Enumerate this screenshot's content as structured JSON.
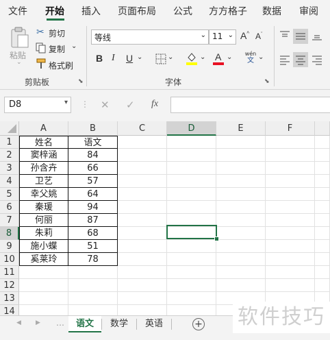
{
  "ribbon_tabs": [
    "文件",
    "开始",
    "插入",
    "页面布局",
    "公式",
    "方方格子",
    "数据",
    "审阅"
  ],
  "clipboard": {
    "paste_label": "粘贴",
    "cut_label": "剪切",
    "copy_label": "复制",
    "format_painter_label": "格式刷",
    "group_label": "剪贴板"
  },
  "font": {
    "font_name": "等线",
    "font_size": "11",
    "grow_label": "A",
    "shrink_label": "A",
    "bold_label": "B",
    "italic_label": "I",
    "underline_label": "U",
    "phonetic_top": "wén",
    "phonetic_bottom": "文",
    "color_label": "A",
    "group_label": "字体"
  },
  "colors": {
    "accent": "#217346",
    "highlight_swatch": "#ffff00",
    "font_color_swatch": "#e81123"
  },
  "formula_bar": {
    "name_box": "D8",
    "cancel_icon": "✕",
    "enter_icon": "✓",
    "fx_label": "fx",
    "formula_value": ""
  },
  "sheet": {
    "columns": [
      "A",
      "B",
      "C",
      "D",
      "E",
      "F"
    ],
    "rows": [
      "1",
      "2",
      "3",
      "4",
      "5",
      "6",
      "7",
      "8",
      "9",
      "10",
      "11",
      "12",
      "13",
      "14"
    ],
    "active_cell": "D8",
    "table": [
      [
        "姓名",
        "语文"
      ],
      [
        "窦梓涵",
        "84"
      ],
      [
        "孙含卉",
        "66"
      ],
      [
        "卫艺",
        "57"
      ],
      [
        "幸父姚",
        "64"
      ],
      [
        "秦瑗",
        "94"
      ],
      [
        "何丽",
        "87"
      ],
      [
        "朱莉",
        "68"
      ],
      [
        "施小蝶",
        "51"
      ],
      [
        "奚莱玲",
        "78"
      ]
    ]
  },
  "sheet_tabs": [
    "语文",
    "数学",
    "英语"
  ],
  "active_sheet": "语文",
  "watermark": "软件技巧"
}
